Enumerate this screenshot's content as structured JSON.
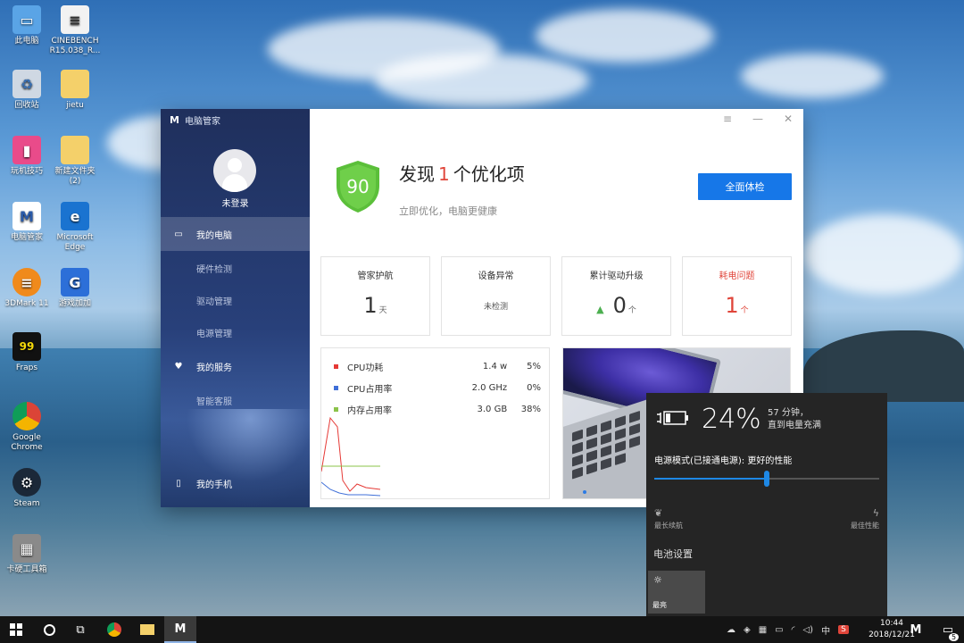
{
  "desktop": {
    "icons": [
      {
        "label": "此电脑",
        "icon": "computer-icon"
      },
      {
        "label": "CINEBENCH R15.038_R...",
        "icon": "file-icon"
      },
      {
        "label": "回收站",
        "icon": "recycle-bin-icon"
      },
      {
        "label": "jietu",
        "icon": "folder-icon"
      },
      {
        "label": "玩机技巧",
        "icon": "app-icon"
      },
      {
        "label": "新建文件夹 (2)",
        "icon": "folder-icon"
      },
      {
        "label": "电脑管家",
        "icon": "pc-manager-icon"
      },
      {
        "label": "Microsoft Edge",
        "icon": "edge-icon"
      },
      {
        "label": "3DMark 11",
        "icon": "3dmark-icon"
      },
      {
        "label": "游戏加加",
        "icon": "game-icon"
      },
      {
        "label": "Fraps",
        "icon": "fraps-icon"
      },
      {
        "label": "Google Chrome",
        "icon": "chrome-icon"
      },
      {
        "label": "Steam",
        "icon": "steam-icon"
      },
      {
        "label": "卡硬工具箱",
        "icon": "toolbox-icon"
      }
    ]
  },
  "app": {
    "title": "电脑管家",
    "login": "未登录",
    "nav": [
      {
        "label": "我的电脑",
        "icon": "laptop-icon"
      },
      {
        "label": "硬件检测"
      },
      {
        "label": "驱动管理"
      },
      {
        "label": "电源管理"
      },
      {
        "label": "我的服务",
        "icon": "heart-icon"
      },
      {
        "label": "智能客服"
      },
      {
        "label": "我的手机",
        "icon": "phone-icon"
      }
    ],
    "score": "90",
    "headline_prefix": "发现",
    "headline_count": "1",
    "headline_suffix": "个优化项",
    "subline": "立即优化，电脑更健康",
    "scan_button": "全面体检",
    "cards": [
      {
        "title": "管家护航",
        "value": "1",
        "unit": "天"
      },
      {
        "title": "设备异常",
        "value": "未检测"
      },
      {
        "title": "累计驱动升级",
        "value": "0",
        "unit": "个"
      },
      {
        "title": "耗电问题",
        "value": "1",
        "unit": "个"
      }
    ],
    "stats": [
      {
        "label": "CPU功耗",
        "v1": "1.4 w",
        "v2": "5%",
        "color": "#e53935"
      },
      {
        "label": "CPU占用率",
        "v1": "2.0 GHz",
        "v2": "0%",
        "color": "#3f6fd8"
      },
      {
        "label": "内存占用率",
        "v1": "3.0 GB",
        "v2": "38%",
        "color": "#8bc34a"
      }
    ]
  },
  "battery": {
    "percent": "24%",
    "time_line1": "57 分钟，",
    "time_line2": "直到电量充满",
    "mode": "电源模式(已接通电源): 更好的性能",
    "slider_fraction": 0.5,
    "left_label": "最长续航",
    "right_label": "最佳性能",
    "settings": "电池设置",
    "brightness": "最亮"
  },
  "taskbar": {
    "ime": "中",
    "time": "10:44",
    "date": "2018/12/21",
    "notification_count": "5"
  },
  "colors": {
    "accent": "#1677e8",
    "alert": "#e0453a",
    "shield": "#5bbf3a"
  }
}
